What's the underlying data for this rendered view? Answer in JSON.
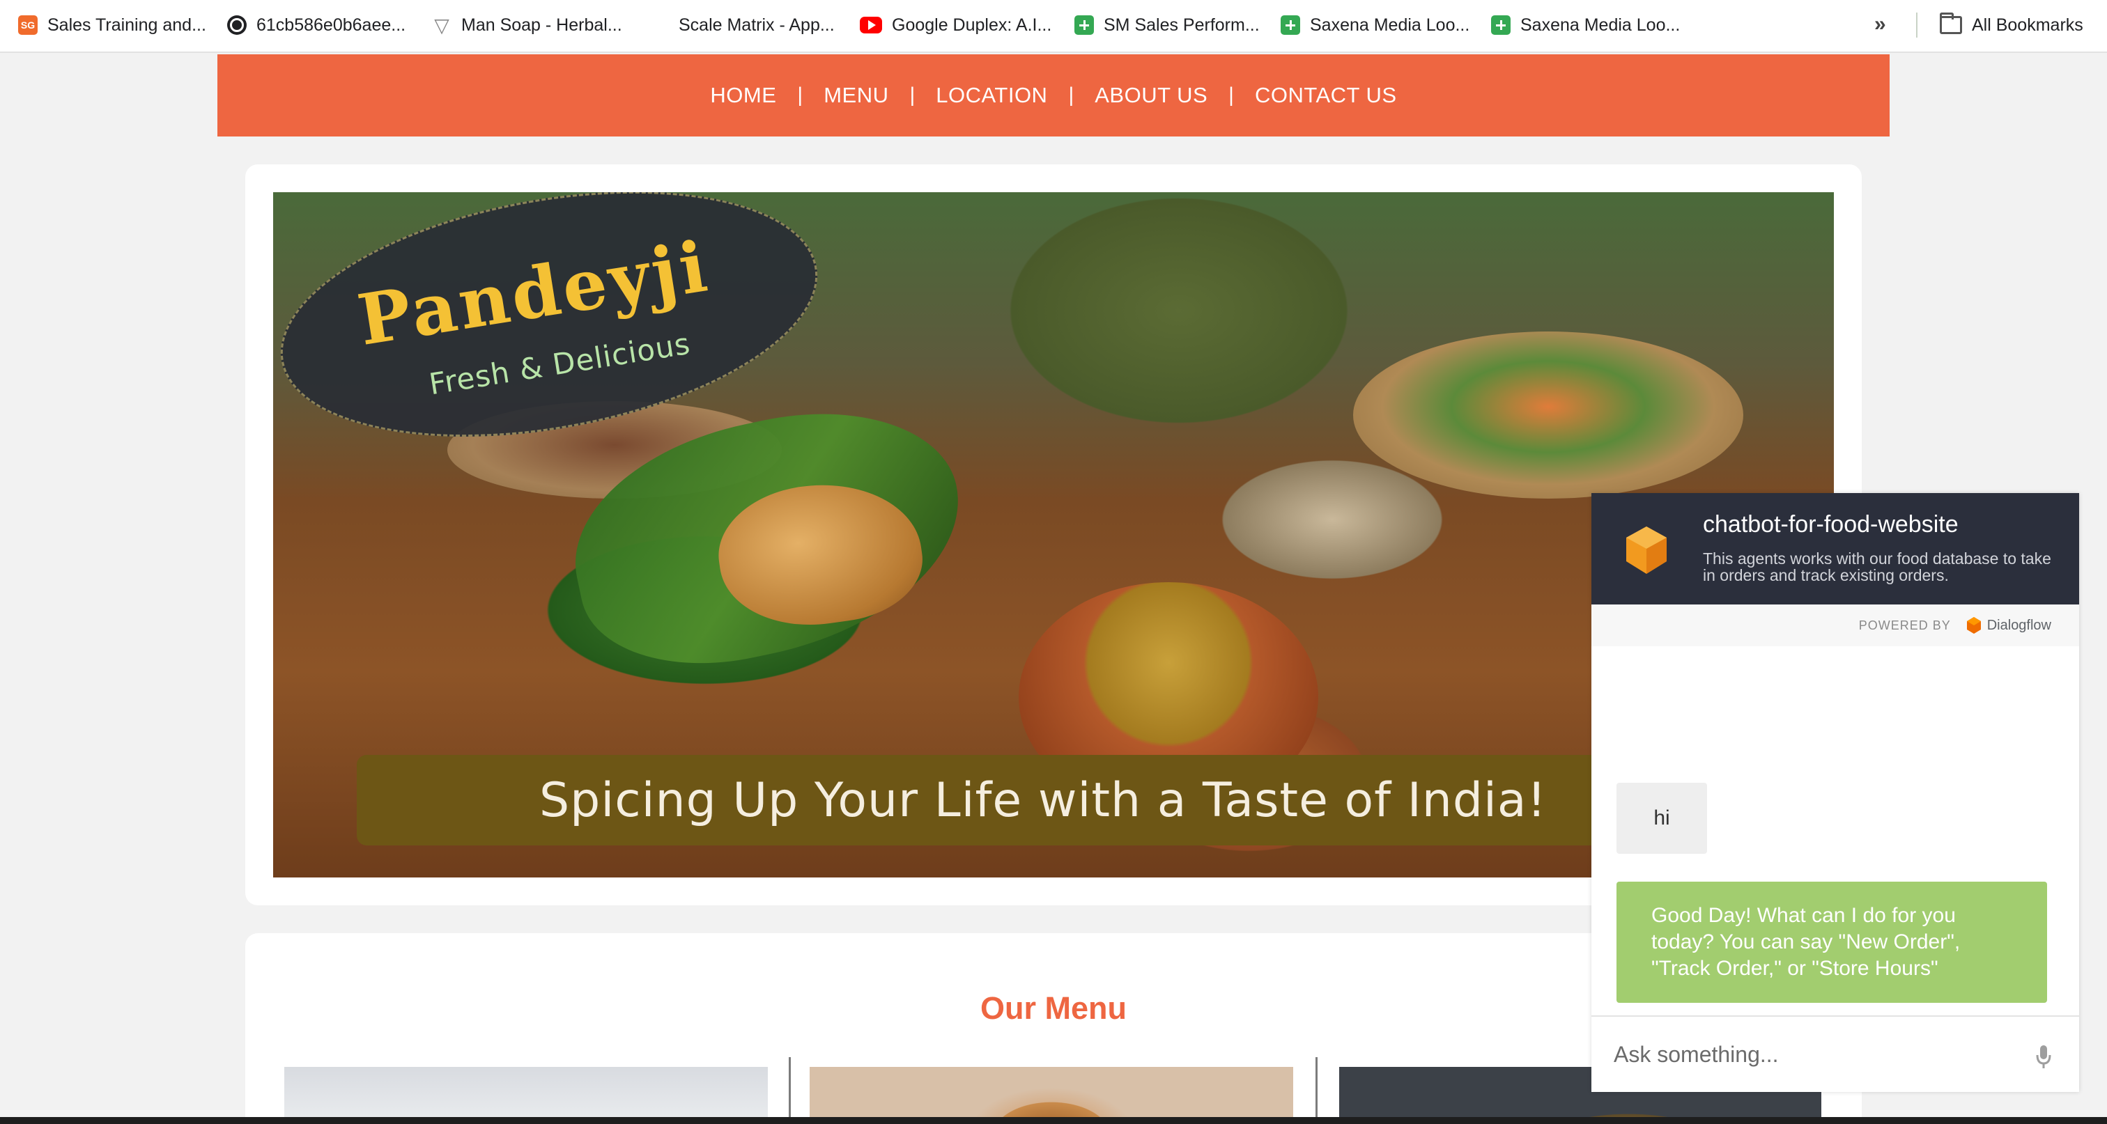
{
  "bookmarks": [
    {
      "label": "Sales Training and...",
      "icon": "sg-icon",
      "icon_text": "SG"
    },
    {
      "label": "61cb586e0b6aee...",
      "icon": "globe-icon"
    },
    {
      "label": "Man Soap - Herbal...",
      "icon": "triangle-icon"
    },
    {
      "label": "Scale Matrix - App...",
      "icon": "blank-icon"
    },
    {
      "label": "Google Duplex: A.I...",
      "icon": "youtube-icon"
    },
    {
      "label": "SM Sales Perform...",
      "icon": "sheets-icon"
    },
    {
      "label": "Saxena Media Loo...",
      "icon": "sheets-icon"
    },
    {
      "label": "Saxena Media Loo...",
      "icon": "sheets-icon"
    }
  ],
  "bookmarks_more": "»",
  "all_bookmarks": "All Bookmarks",
  "nav": {
    "links": [
      "HOME",
      "MENU",
      "LOCATION",
      "ABOUT US",
      "CONTACT US"
    ],
    "separator": "|"
  },
  "hero": {
    "brand": "Pandeyji",
    "tagline": "Fresh & Delicious",
    "slogan": "Spicing Up Your Life with a Taste of India!"
  },
  "menu_section": {
    "title": "Our Menu"
  },
  "chat": {
    "title": "chatbot-for-food-website",
    "description": "This agents works with our food database to take in orders and track existing orders.",
    "powered_by": "POWERED BY",
    "provider": "Dialogflow",
    "messages": [
      {
        "from": "user",
        "text": "hi"
      },
      {
        "from": "bot",
        "text": "Good Day! What can I do for you today? You can say \"New Order\", \"Track Order,\" or \"Store Hours\""
      }
    ],
    "input_placeholder": "Ask something..."
  },
  "colors": {
    "nav_bg": "#ee6641",
    "accent": "#ee6641",
    "chat_header": "#2b2f3c",
    "bot_bubble": "#a2cd6f",
    "user_bubble": "#eeeeee"
  }
}
